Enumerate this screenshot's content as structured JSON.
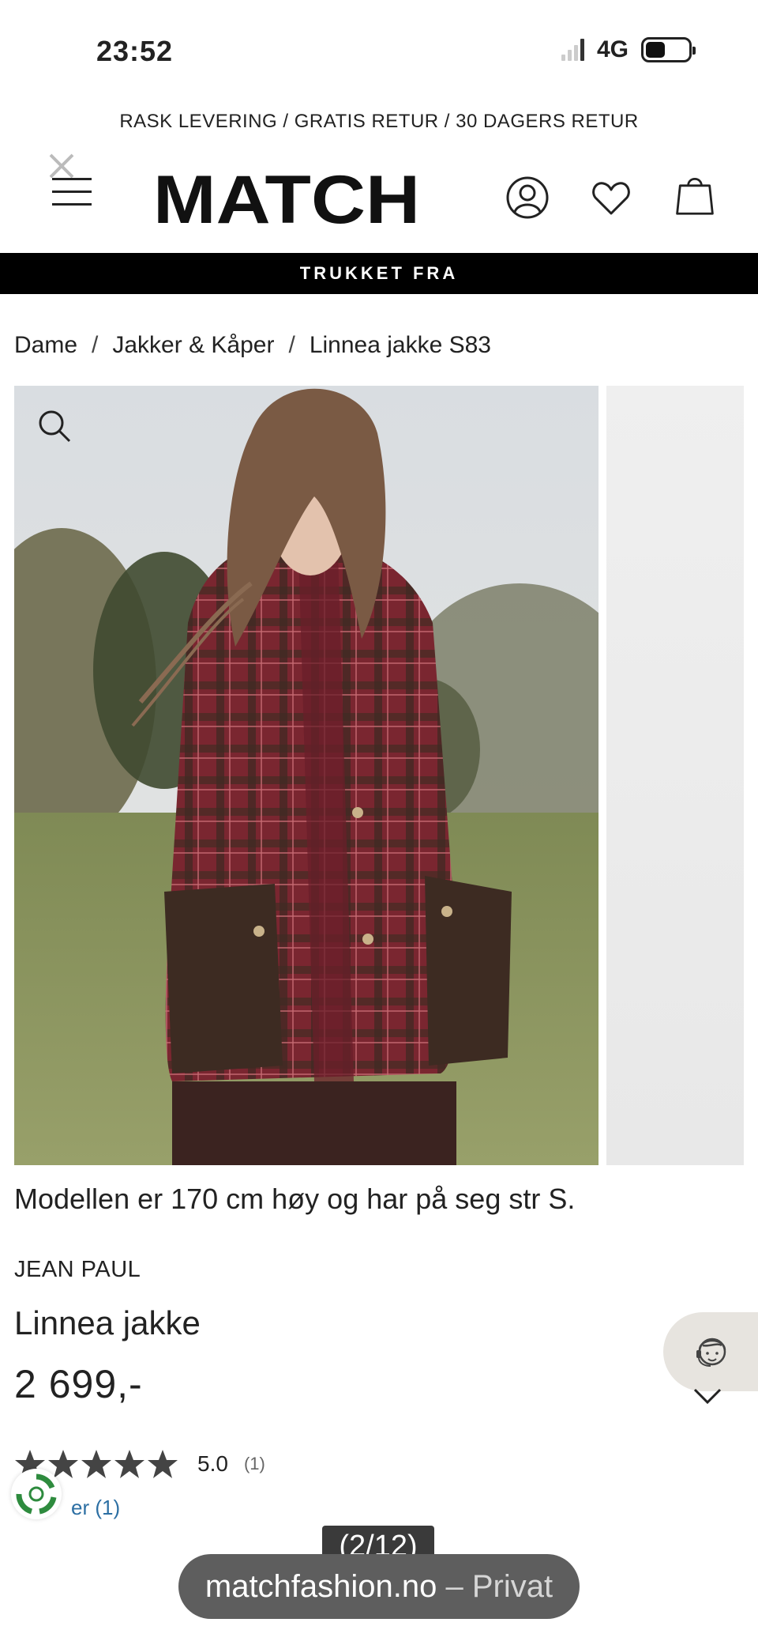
{
  "status_bar": {
    "time": "23:52",
    "network": "4G"
  },
  "promo": {
    "text": "RASK LEVERING / GRATIS RETUR / 30 DAGERS RETUR"
  },
  "header": {
    "logo_text": "MATCH"
  },
  "banner": {
    "text": "TRUKKET FRA"
  },
  "breadcrumb": {
    "items": [
      "Dame",
      "Jakker & Kåper",
      "Linnea jakke S83"
    ],
    "separator": "/"
  },
  "gallery": {
    "caption": "Modellen er 170 cm høy og har på seg str S.",
    "counter": "(2/12)"
  },
  "product": {
    "brand": "JEAN PAUL",
    "name": "Linnea jakke",
    "price": "2 699,-",
    "rating": {
      "stars": 5,
      "value": "5.0",
      "count": "(1)"
    },
    "reviews_link": "er (1)"
  },
  "browser": {
    "domain": "matchfashion.no",
    "separator": " – ",
    "mode": "Privat"
  },
  "colors": {
    "banner_bg": "#000000",
    "link": "#2c6fa3",
    "chat_bg": "#e7e4df",
    "pill_bg": "#5e5e5e"
  }
}
